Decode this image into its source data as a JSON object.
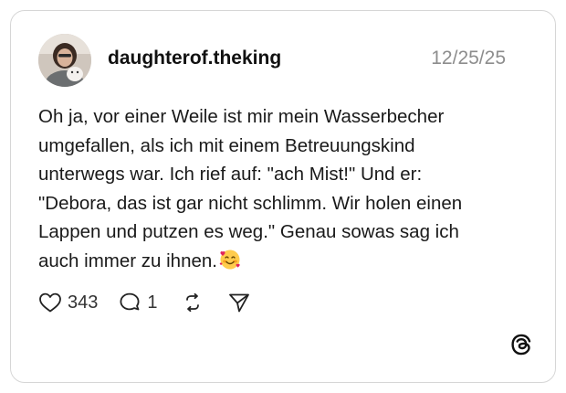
{
  "post": {
    "username": "daughterof.theking",
    "date": "12/25/25",
    "text_lines": [
      "Oh ja, vor einer Weile ist mir mein Wasserbecher",
      "umgefallen, als ich mit einem Betreuungskind",
      "unterwegs war. Ich rief auf: \"ach Mist!\" Und er:",
      "\"Debora, das ist gar nicht schlimm. Wir holen einen",
      "Lappen und putzen es weg.\" Genau sowas sag ich",
      "auch immer zu ihnen."
    ],
    "emoji": "smiling-face-with-hearts"
  },
  "actions": {
    "like_count": "343",
    "reply_count": "1",
    "like_icon": "heart-icon",
    "reply_icon": "comment-icon",
    "repost_icon": "repost-icon",
    "share_icon": "send-icon"
  },
  "brand": {
    "logo_icon": "threads-logo-icon"
  }
}
